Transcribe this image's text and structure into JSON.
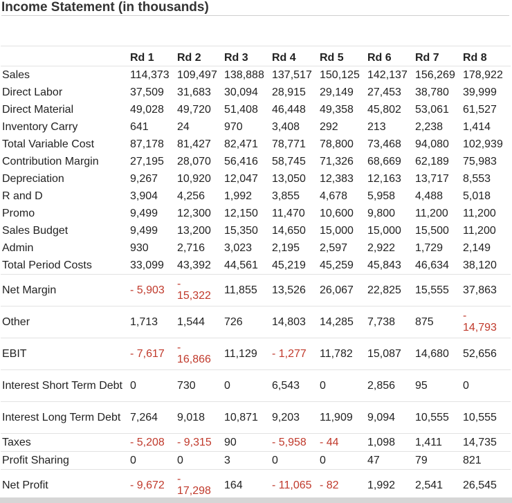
{
  "title": "Income Statement (in thousands)",
  "columns": [
    "Rd 1",
    "Rd 2",
    "Rd 3",
    "Rd 4",
    "Rd 5",
    "Rd 6",
    "Rd 7",
    "Rd 8"
  ],
  "rows": [
    {
      "label": "Sales",
      "values": [
        "114,373",
        "109,497",
        "138,888",
        "137,517",
        "150,125",
        "142,137",
        "156,269",
        "178,922"
      ]
    },
    {
      "label": "Direct Labor",
      "values": [
        "37,509",
        "31,683",
        "30,094",
        "28,915",
        "29,149",
        "27,453",
        "38,780",
        "39,999"
      ]
    },
    {
      "label": "Direct Material",
      "values": [
        "49,028",
        "49,720",
        "51,408",
        "46,448",
        "49,358",
        "45,802",
        "53,061",
        "61,527"
      ]
    },
    {
      "label": "Inventory Carry",
      "values": [
        "641",
        "24",
        "970",
        "3,408",
        "292",
        "213",
        "2,238",
        "1,414"
      ]
    },
    {
      "label": "Total Variable Cost",
      "values": [
        "87,178",
        "81,427",
        "82,471",
        "78,771",
        "78,800",
        "73,468",
        "94,080",
        "102,939"
      ]
    },
    {
      "label": "Contribution Margin",
      "values": [
        "27,195",
        "28,070",
        "56,416",
        "58,745",
        "71,326",
        "68,669",
        "62,189",
        "75,983"
      ]
    },
    {
      "label": "Depreciation",
      "values": [
        "9,267",
        "10,920",
        "12,047",
        "13,050",
        "12,383",
        "12,163",
        "13,717",
        "8,553"
      ]
    },
    {
      "label": "R and D",
      "values": [
        "3,904",
        "4,256",
        "1,992",
        "3,855",
        "4,678",
        "5,958",
        "4,488",
        "5,018"
      ]
    },
    {
      "label": "Promo",
      "values": [
        "9,499",
        "12,300",
        "12,150",
        "11,470",
        "10,600",
        "9,800",
        "11,200",
        "11,200"
      ]
    },
    {
      "label": "Sales Budget",
      "values": [
        "9,499",
        "13,200",
        "15,350",
        "14,650",
        "15,000",
        "15,000",
        "15,500",
        "11,200"
      ]
    },
    {
      "label": "Admin",
      "values": [
        "930",
        "2,716",
        "3,023",
        "2,195",
        "2,597",
        "2,922",
        "1,729",
        "2,149"
      ]
    },
    {
      "label": "Total Period Costs",
      "values": [
        "33,099",
        "43,392",
        "44,561",
        "45,219",
        "45,259",
        "45,843",
        "46,634",
        "38,120"
      ]
    },
    {
      "label": "Net Margin",
      "values": [
        "- 5,903",
        "- 15,322",
        "11,855",
        "13,526",
        "26,067",
        "22,825",
        "15,555",
        "37,863"
      ]
    },
    {
      "label": "Other",
      "values": [
        "1,713",
        "1,544",
        "726",
        "14,803",
        "14,285",
        "7,738",
        "875",
        "- 14,793"
      ]
    },
    {
      "label": "EBIT",
      "values": [
        "- 7,617",
        "- 16,866",
        "11,129",
        "- 1,277",
        "11,782",
        "15,087",
        "14,680",
        "52,656"
      ]
    },
    {
      "label": "Interest Short Term Debt",
      "values": [
        "0",
        "730",
        "0",
        "6,543",
        "0",
        "2,856",
        "95",
        "0"
      ]
    },
    {
      "label": "Interest Long Term Debt",
      "values": [
        "7,264",
        "9,018",
        "10,871",
        "9,203",
        "11,909",
        "9,094",
        "10,555",
        "10,555"
      ]
    },
    {
      "label": "Taxes",
      "values": [
        "- 5,208",
        "- 9,315",
        "90",
        "- 5,958",
        "- 44",
        "1,098",
        "1,411",
        "14,735"
      ]
    },
    {
      "label": "Profit Sharing",
      "values": [
        "0",
        "0",
        "3",
        "0",
        "0",
        "47",
        "79",
        "821"
      ]
    },
    {
      "label": "Net Profit",
      "values": [
        "- 9,672",
        "- 17,298",
        "164",
        "- 11,065",
        "- 82",
        "1,992",
        "2,541",
        "26,545"
      ]
    }
  ],
  "colors": {
    "negative": "#c0392b",
    "text": "#222222",
    "rule": "#e2e2e2"
  }
}
